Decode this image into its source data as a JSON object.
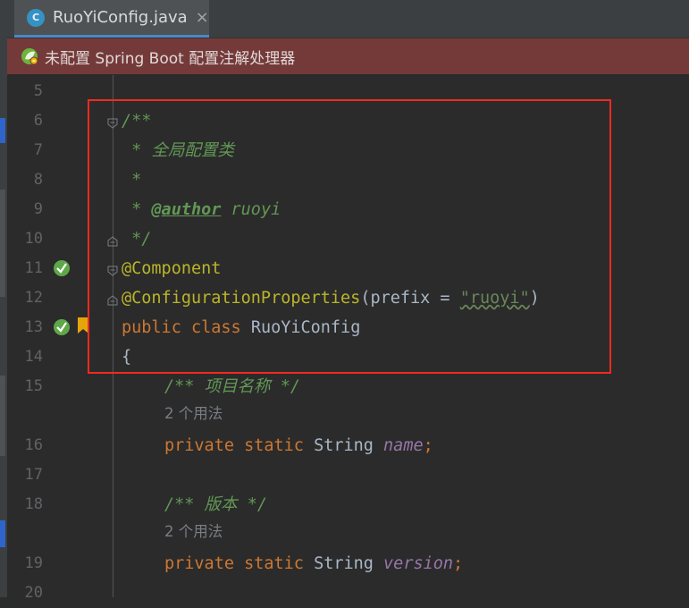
{
  "tab": {
    "label": "RuoYiConfig.java",
    "icon_letter": "C",
    "close": "×"
  },
  "banner": {
    "text": "未配置 Spring Boot 配置注解处理器"
  },
  "line_numbers": [
    "5",
    "6",
    "7",
    "8",
    "9",
    "10",
    "11",
    "12",
    "13",
    "14",
    "15",
    "16",
    "17",
    "18",
    "19",
    "20"
  ],
  "code": {
    "doc_open": "/**",
    "doc_desc": " * 全局配置类",
    "doc_blank": " *",
    "doc_author_star": " * ",
    "doc_author_tag": "@author",
    "doc_author_name": " ruoyi",
    "doc_close": " */",
    "ann_component": "@Component",
    "ann_config": "@ConfigurationProperties",
    "ann_config_paren_open": "(prefix = ",
    "ann_config_value": "\"ruoyi\"",
    "ann_config_paren_close": ")",
    "class_public": "public",
    "class_class": "class",
    "class_name": "RuoYiConfig",
    "brace_open": "{",
    "comment_name": "/** 项目名称 */",
    "usage_1": "2 个用法",
    "field1_private": "private",
    "field1_static": "static",
    "field1_type": "String",
    "field1_name": "name",
    "field1_semi": ";",
    "comment_version": "/** 版本 */",
    "usage_2": "2 个用法",
    "field2_private": "private",
    "field2_static": "static",
    "field2_type": "String",
    "field2_name": "version",
    "field2_semi": ";"
  },
  "colors": {
    "background": "#2b2b2b",
    "banner": "#743a3a",
    "highlight_box": "#f22a1f",
    "keyword": "#cc7832",
    "annotation": "#bbb529",
    "comment": "#629755"
  }
}
